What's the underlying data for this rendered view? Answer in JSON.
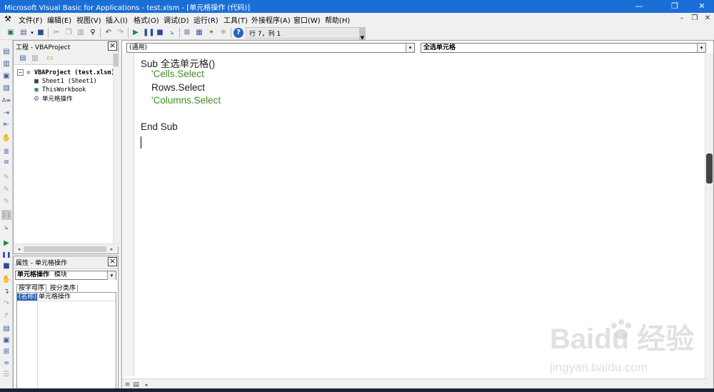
{
  "window": {
    "title": "Microsoft Visual Basic for Applications - test.xlsm - [单元格操作 (代码)]",
    "controls": {
      "minimize": "—",
      "restore": "❐",
      "close": "✕"
    }
  },
  "menu": {
    "items": [
      "文件(F)",
      "编辑(E)",
      "视图(V)",
      "插入(I)",
      "格式(O)",
      "调试(D)",
      "运行(R)",
      "工具(T)",
      "外接程序(A)",
      "窗口(W)",
      "帮助(H)"
    ],
    "mdi_controls": {
      "minimize": "–",
      "restore": "❐",
      "close": "✕"
    }
  },
  "toolbar": {
    "position": "行 7，列 1"
  },
  "project": {
    "title": "工程 - VBAProject",
    "root": "VBAProject (test.xlsm)",
    "items": [
      "Sheet1 (Sheet1)",
      "ThisWorkbook",
      "单元格操作"
    ]
  },
  "properties": {
    "title": "属性 - 单元格操作",
    "object_name": "单元格操作",
    "object_type": "模块",
    "tabs": [
      "按字母序",
      "按分类序"
    ],
    "rows": [
      {
        "name": "(名称)",
        "value": "单元格操作"
      }
    ]
  },
  "code": {
    "object_combo": "(通用)",
    "proc_combo": "全选单元格",
    "lines": [
      {
        "text": "Sub 全选单元格()",
        "kind": "kw"
      },
      {
        "text": "    'Cells.Select",
        "kind": "comment"
      },
      {
        "text": "    Rows.Select",
        "kind": "kw"
      },
      {
        "text": "    'Columns.Select",
        "kind": "comment"
      },
      {
        "text": "",
        "kind": "kw"
      },
      {
        "text": "End Sub",
        "kind": "kw"
      }
    ]
  },
  "watermark": {
    "brand": "Baidu 经验",
    "url": "jingyan.baidu.com"
  }
}
